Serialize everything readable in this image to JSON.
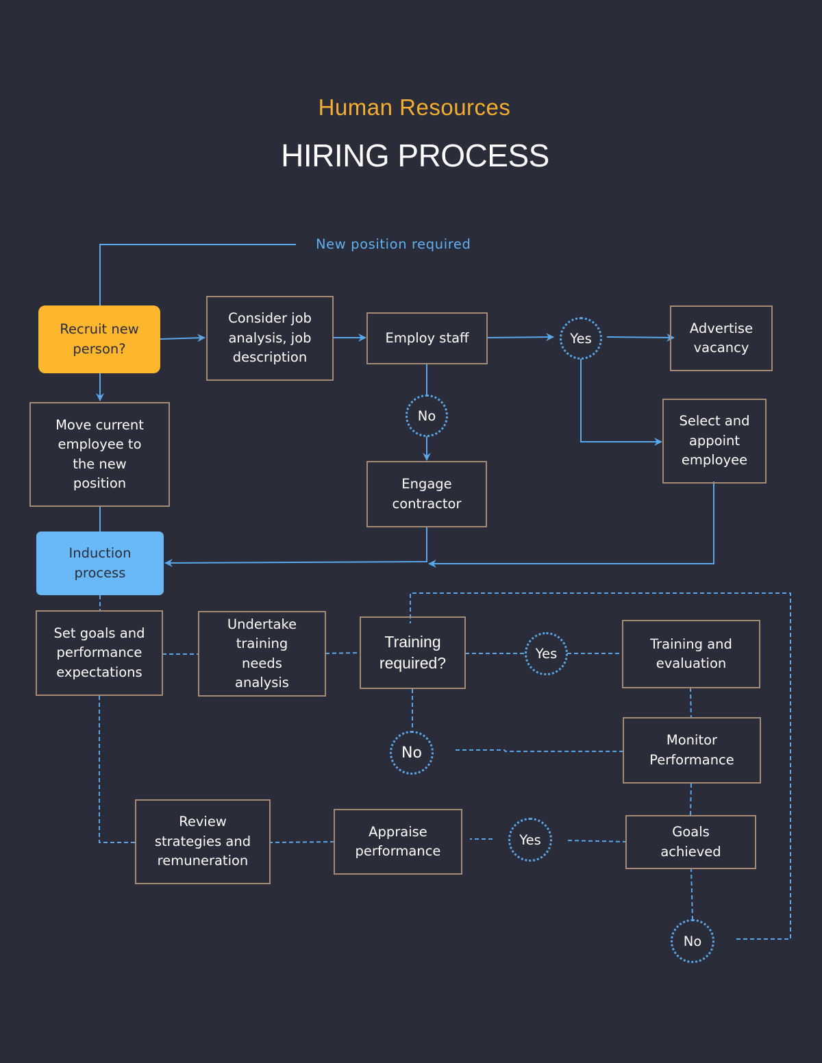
{
  "header": {
    "subtitle": "Human Resources",
    "title": "HIRING PROCESS"
  },
  "colors": {
    "background": "#2b2c39",
    "accent_yellow": "#fdb72d",
    "accent_blue": "#69b9f9",
    "connector": "#5aa8ea",
    "box_border": "#a68a74",
    "subtitle": "#f4b02a"
  },
  "start_label": "New position required",
  "nodes": {
    "recruit": "Recruit new\nperson?",
    "consider": "Consider job\nanalysis, job\ndescription",
    "employ": "Employ staff",
    "advertise": "Advertise\nvacancy",
    "select": "Select and\nappoint\nemployee",
    "move": "Move current\nemployee to\nthe new\nposition",
    "engage": "Engage\ncontractor",
    "induction": "Induction\nprocess",
    "set_goals": "Set goals and\nperformance\nexpectations",
    "undertake": "Undertake\ntraining\nneeds\nanalysis",
    "training_required": "Training\nrequired?",
    "training_eval": "Training and\nevaluation",
    "monitor": "Monitor\nPerformance",
    "review": "Review\nstrategies and\nremuneration",
    "appraise": "Appraise\nperformance",
    "goals_achieved": "Goals\nachieved"
  },
  "decisions": {
    "employ_yes": "Yes",
    "employ_no": "No",
    "training_yes": "Yes",
    "training_no": "No",
    "goals_yes": "Yes",
    "goals_no": "No"
  }
}
